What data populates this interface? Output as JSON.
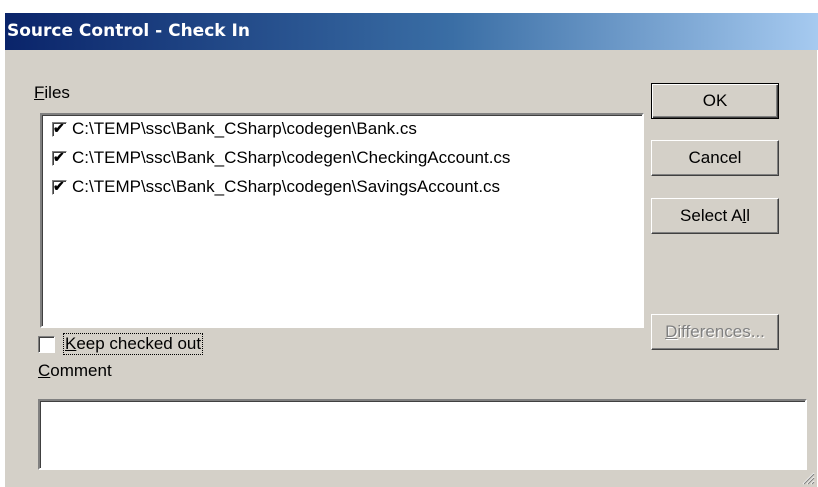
{
  "dialog": {
    "title": "Source Control - Check In"
  },
  "files": {
    "label_accel": "F",
    "label_rest": "iles",
    "items": [
      {
        "path": "C:\\TEMP\\ssc\\Bank_CSharp\\codegen\\Bank.cs",
        "checked": true
      },
      {
        "path": "C:\\TEMP\\ssc\\Bank_CSharp\\codegen\\CheckingAccount.cs",
        "checked": true
      },
      {
        "path": "C:\\TEMP\\ssc\\Bank_CSharp\\codegen\\SavingsAccount.cs",
        "checked": true
      }
    ]
  },
  "keep_checked_out": {
    "label_accel": "K",
    "label_rest": "eep checked out",
    "checked": false
  },
  "comment": {
    "label_accel": "C",
    "label_rest": "omment",
    "value": ""
  },
  "buttons": {
    "ok": "OK",
    "cancel": "Cancel",
    "select_all_pre": "Select A",
    "select_all_accel": "l",
    "select_all_post": "l",
    "differences_accel": "D",
    "differences_rest": "ifferences..."
  },
  "colors": {
    "face": "#d4d0c8",
    "title_start": "#0a246a",
    "title_end": "#a6caf0"
  }
}
